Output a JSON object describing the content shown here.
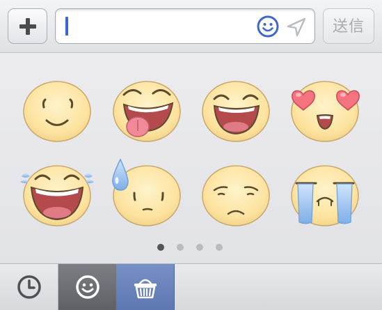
{
  "input_bar": {
    "plus_icon": "plus-icon",
    "input_value": "",
    "smiley_icon": "smiley-icon",
    "location_icon": "location-arrow-icon",
    "send_label": "送信"
  },
  "sticker_panel": {
    "stickers": [
      {
        "name": "smile-face-sticker"
      },
      {
        "name": "tongue-out-face-sticker"
      },
      {
        "name": "grin-face-sticker"
      },
      {
        "name": "heart-eyes-face-sticker"
      },
      {
        "name": "laugh-tears-face-sticker"
      },
      {
        "name": "sweat-drop-face-sticker"
      },
      {
        "name": "worried-face-sticker"
      },
      {
        "name": "crying-face-sticker"
      }
    ],
    "page_count": 4,
    "active_page": 1
  },
  "tab_bar": {
    "tabs": [
      {
        "icon": "clock-icon",
        "selected": false
      },
      {
        "icon": "emoji-face-icon",
        "selected": true
      },
      {
        "icon": "shop-basket-icon",
        "selected": false
      }
    ]
  },
  "colors": {
    "caret": "#3c62d8",
    "smiley_blue": "#3e66cf",
    "face_fill": "#fde6a8",
    "emoji_tab": "#6c6e73",
    "shop_tab": "#6a84bc"
  }
}
